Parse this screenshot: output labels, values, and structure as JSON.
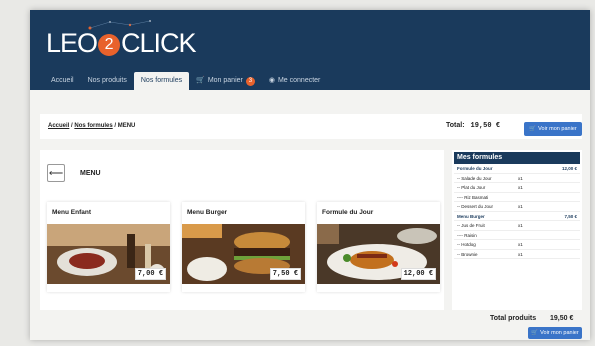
{
  "brand": {
    "left": "LEO",
    "middle": "2",
    "right": "CLICK"
  },
  "nav": {
    "items": [
      {
        "label": "Accueil"
      },
      {
        "label": "Nos produits"
      },
      {
        "label": "Nos formules"
      },
      {
        "label": "Mon panier"
      },
      {
        "label": "Me connecter"
      }
    ],
    "cart_count": "3"
  },
  "breadcrumb": {
    "home": "Accueil",
    "section": "Nos formules",
    "current": "MENU"
  },
  "totals": {
    "label": "Total:",
    "value": "19,50 €",
    "button": "Voir mon panier"
  },
  "main": {
    "title": "MENU",
    "cards": [
      {
        "name": "Menu Enfant",
        "price": "7,00 €"
      },
      {
        "name": "Menu Burger",
        "price": "7,50 €"
      },
      {
        "name": "Formule du Jour",
        "price": "12,00 €"
      }
    ]
  },
  "sidebar": {
    "title": "Mes formules",
    "rows": [
      {
        "label": "Formule du Jour",
        "qty": "",
        "price": "12,00 €",
        "head": true
      },
      {
        "label": "-- Salade du Jour",
        "qty": "x1",
        "price": ""
      },
      {
        "label": "-- Plat du Jour",
        "qty": "x1",
        "price": ""
      },
      {
        "label": "---- Riz Basmati",
        "qty": "",
        "price": ""
      },
      {
        "label": "-- Dessert du Jour",
        "qty": "x1",
        "price": ""
      },
      {
        "label": "Menu Burger",
        "qty": "",
        "price": "7,50 €",
        "head": true
      },
      {
        "label": "-- Jus de Fruit",
        "qty": "x1",
        "price": ""
      },
      {
        "label": "---- Raisin",
        "qty": "",
        "price": ""
      },
      {
        "label": "-- Hotdog",
        "qty": "x1",
        "price": ""
      },
      {
        "label": "-- Brownie",
        "qty": "x1",
        "price": ""
      }
    ],
    "total_label": "Total produits",
    "total_value": "19,50 €",
    "button": "Voir mon panier"
  }
}
